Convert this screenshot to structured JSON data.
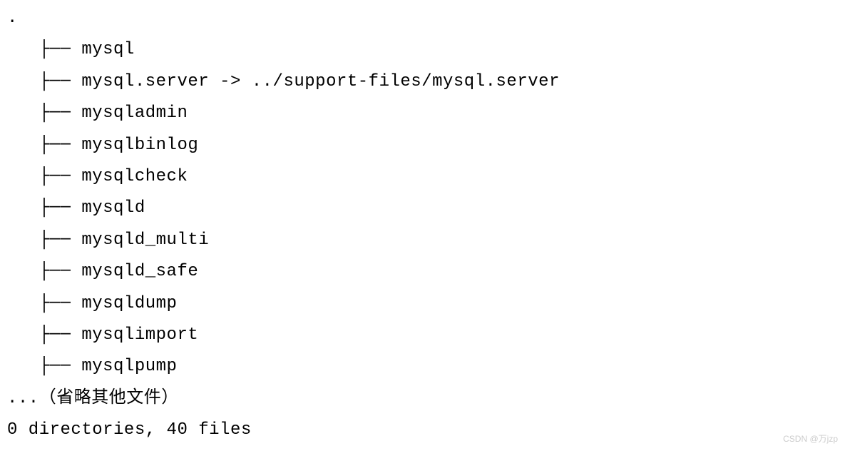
{
  "root": ".",
  "prefix": "├── ",
  "indent": "   ",
  "entries": [
    "mysql",
    "mysql.server -> ../support-files/mysql.server",
    "mysqladmin",
    "mysqlbinlog",
    "mysqlcheck",
    "mysqld",
    "mysqld_multi",
    "mysqld_safe",
    "mysqldump",
    "mysqlimport",
    "mysqlpump"
  ],
  "omitted_note": "...（省略其他文件）",
  "summary": "0 directories, 40 files",
  "watermark": "CSDN @万jzp"
}
